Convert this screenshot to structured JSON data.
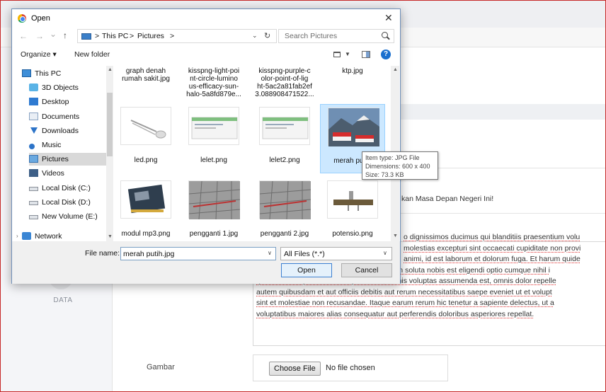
{
  "dialog": {
    "title": "Open",
    "close_symbol": "✕",
    "nav": {
      "back": "←",
      "forward": "→",
      "recent": "⌄",
      "up": "↑"
    },
    "breadcrumb": [
      "This PC",
      "Pictures"
    ],
    "breadcrumb_sep": ">",
    "search_placeholder": "Search Pictures",
    "toolbar": {
      "organize": "Organize ▾",
      "new_folder": "New folder",
      "help": "?"
    },
    "sidebar": [
      {
        "label": "This PC",
        "icon": "computer-icon"
      },
      {
        "label": "3D Objects",
        "icon": "3d-objects-icon"
      },
      {
        "label": "Desktop",
        "icon": "desktop-icon"
      },
      {
        "label": "Documents",
        "icon": "documents-icon"
      },
      {
        "label": "Downloads",
        "icon": "downloads-icon"
      },
      {
        "label": "Music",
        "icon": "music-icon"
      },
      {
        "label": "Pictures",
        "icon": "pictures-icon",
        "selected": true
      },
      {
        "label": "Videos",
        "icon": "videos-icon"
      },
      {
        "label": "Local Disk (C:)",
        "icon": "drive-icon"
      },
      {
        "label": "Local Disk (D:)",
        "icon": "drive-icon"
      },
      {
        "label": "New Volume (E:)",
        "icon": "drive-icon"
      },
      {
        "label": "Network",
        "icon": "network-icon"
      }
    ],
    "files_row1": [
      {
        "name": "graph denah\nrumah sakit.jpg"
      },
      {
        "name": "kisspng-light-poi\nnt-circle-lumino\nus-efficacy-sun-\nhalo-5a8fd879e..."
      },
      {
        "name": "kisspng-purple-c\nolor-point-of-lig\nht-5ac2a81fab2ef\n3.088908471522..."
      },
      {
        "name": "ktp.jpg"
      }
    ],
    "files_row2": [
      {
        "name": "led.png",
        "thumb": "led-thumb"
      },
      {
        "name": "lelet.png",
        "thumb": "screen-thumb"
      },
      {
        "name": "lelet2.png",
        "thumb": "screen-thumb"
      },
      {
        "name": "merah putih.",
        "thumb": "flag-thumb",
        "selected": true
      }
    ],
    "files_row3": [
      {
        "name": "modul mp3.png",
        "thumb": "chip-thumb"
      },
      {
        "name": "pengganti 1.jpg",
        "thumb": "grid-thumb"
      },
      {
        "name": "pengganti 2.jpg",
        "thumb": "grid-thumb"
      },
      {
        "name": "potensio.png",
        "thumb": "potentiometer-thumb"
      }
    ],
    "tooltip": {
      "type": "Item type: JPG File",
      "dimensions": "Dimensions: 600 x 400",
      "size": "Size: 73.3 KB"
    },
    "file_name_label": "File name:",
    "file_name_value": "merah putih.jpg",
    "file_type_value": "All Files (*.*)",
    "open_label": "Open",
    "cancel_label": "Cancel"
  },
  "page": {
    "sidebar_label": "DATA",
    "headline_fragment": "kan Masa Depan Negeri Ini!",
    "body_lines": [
      "o dignissimos ducimus qui blanditiis praesentium volu",
      "molestias excepturi sint occaecati cupiditate non provi",
      "animi, id est laborum et dolorum fuga. Et harum quide",
      "expedita distinctio. Nam libero tempore, cum soluta nobis est eligendi optio cumque nihil i",
      "quod maxime placeat facere possimus, omnis voluptas assumenda est, omnis dolor repelle",
      "autem quibusdam et aut officiis debitis aut rerum necessitatibus saepe eveniet ut et volupt",
      "sint et molestiae non recusandae. Itaque earum rerum hic tenetur a sapiente delectus, ut a",
      "voluptatibus maiores alias consequatur aut perferendis doloribus asperiores repellat."
    ],
    "gambar_label": "Gambar",
    "choose_file_label": "Choose File",
    "no_file_text": "No file chosen"
  },
  "colors": {
    "accent": "#1a6fce",
    "selection": "#cce8ff",
    "border_accent": "#c62828"
  }
}
